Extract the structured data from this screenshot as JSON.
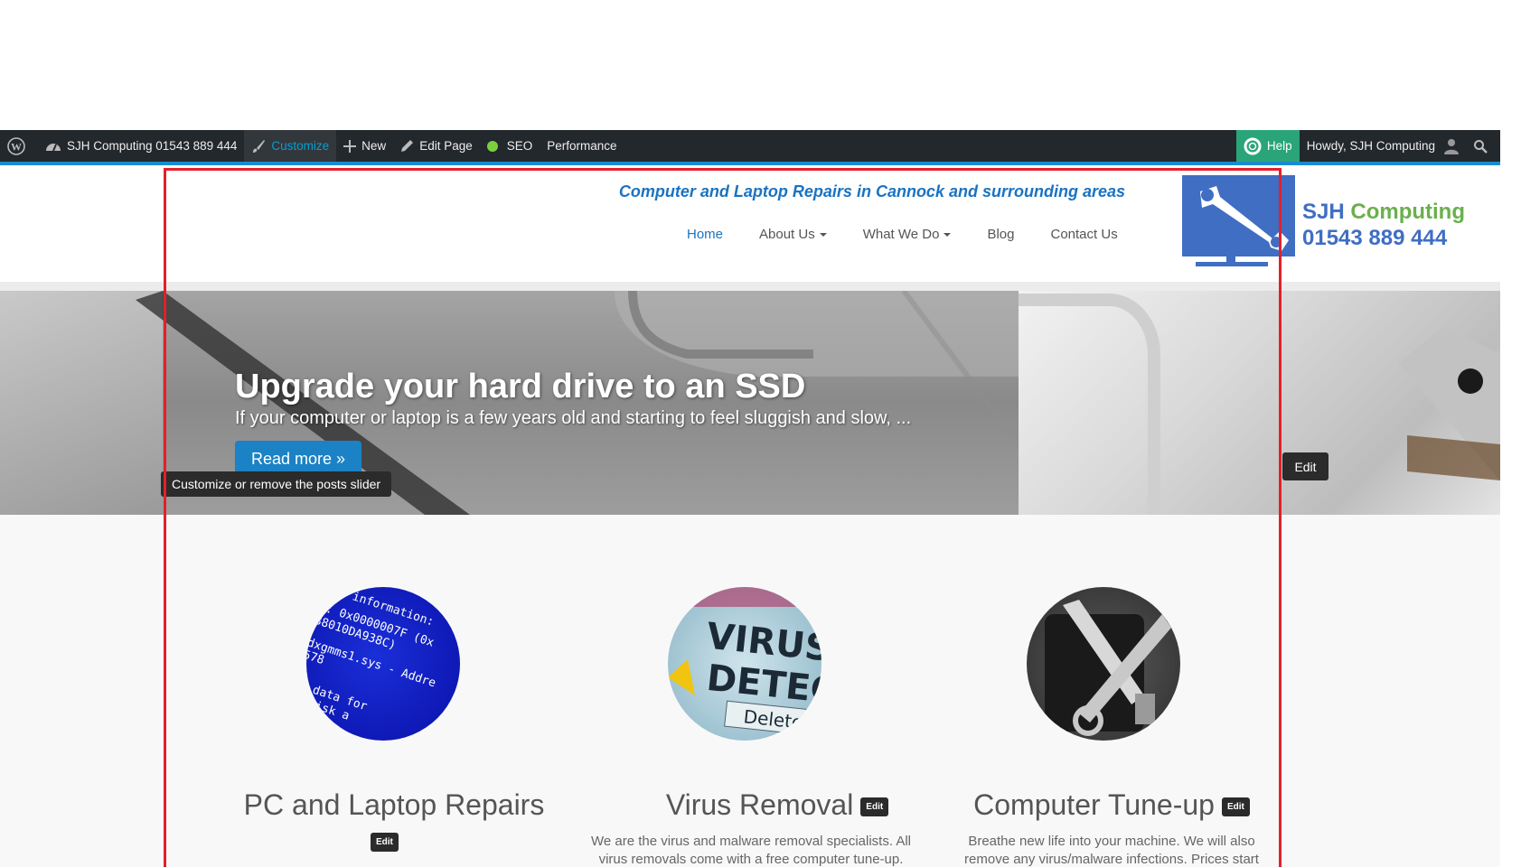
{
  "adminbar": {
    "site": "SJH Computing 01543 889 444",
    "customize": "Customize",
    "new": "New",
    "edit_page": "Edit Page",
    "seo": "SEO",
    "performance": "Performance",
    "help": "Help",
    "howdy": "Howdy, SJH Computing",
    "colors": {
      "bar": "#23282d",
      "accent": "#00a0d2",
      "help": "#2aa579",
      "seo_dot": "#7ad03a"
    }
  },
  "header": {
    "tagline": "Computer and Laptop Repairs in Cannock and surrounding areas",
    "nav": [
      "Home",
      "About Us",
      "What We Do",
      "Blog",
      "Contact Us"
    ],
    "brand_name_a": "SJH",
    "brand_name_b": "Computing",
    "brand_phone": "01543 889 444"
  },
  "slider": {
    "title": "Upgrade your hard drive to an SSD",
    "text": "If your computer or laptop is a few years old and starting to feel sluggish and slow, ...",
    "button": "Read more »",
    "tooltip": "Customize or remove the posts slider",
    "edit": "Edit"
  },
  "services": [
    {
      "title": "PC and Laptop Repairs",
      "edit": "Edit",
      "desc": ""
    },
    {
      "title": "Virus Removal",
      "edit": "Edit",
      "desc": "We are the virus and malware removal specialists. All virus removals come with a free computer tune-up."
    },
    {
      "title": "Computer Tune-up",
      "edit": "Edit",
      "desc": "Breathe new life into your machine. We will also remove any virus/malware infections. Prices start"
    }
  ],
  "images": {
    "bsod_text": [
      "information:",
      "p: 0x0000007F (0x",
      "88010DA938C)",
      "dxgmms1.sys - Addre",
      "578",
      "data for",
      "disk a"
    ],
    "virus_text": [
      "VIRUS",
      "DETEC",
      "Delete"
    ]
  }
}
